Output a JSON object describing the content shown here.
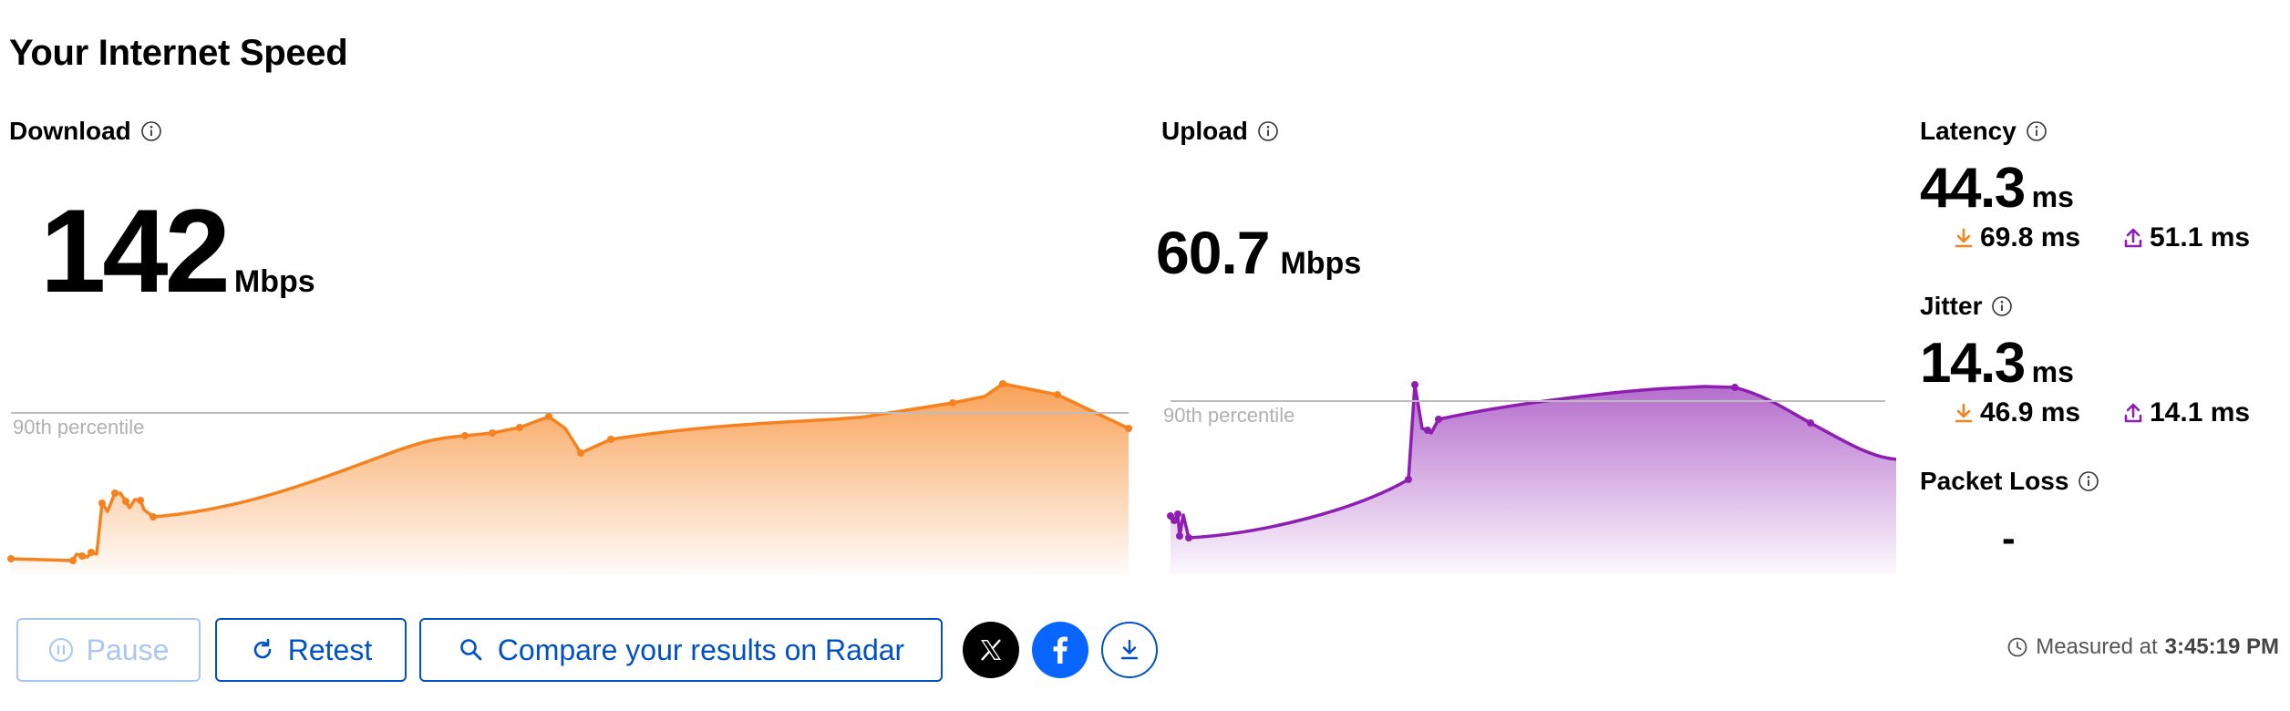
{
  "page": {
    "title": "Your Internet Speed"
  },
  "download": {
    "label": "Download",
    "value": "142",
    "unit": "Mbps",
    "percentile_label": "90th percentile",
    "color": "#f6821f",
    "icon": "info-icon"
  },
  "upload": {
    "label": "Upload",
    "value": "60.7",
    "unit": "Mbps",
    "percentile_label": "90th percentile",
    "color": "#8d1eb1",
    "icon": "info-icon"
  },
  "latency": {
    "label": "Latency",
    "value": "44.3",
    "unit": "ms",
    "download_value": "69.8 ms",
    "upload_value": "51.1 ms"
  },
  "jitter": {
    "label": "Jitter",
    "value": "14.3",
    "unit": "ms",
    "download_value": "46.9 ms",
    "upload_value": "14.1 ms"
  },
  "packet_loss": {
    "label": "Packet Loss",
    "value": "-"
  },
  "buttons": {
    "pause": "Pause",
    "retest": "Retest",
    "compare": "Compare your results on Radar"
  },
  "share": {
    "x_icon": "x-logo-icon",
    "facebook_icon": "facebook-icon",
    "download_icon": "download-icon"
  },
  "measured": {
    "prefix": "Measured at",
    "time": "3:45:19 PM"
  },
  "colors": {
    "accent": "#0051c3",
    "download": "#f6821f",
    "upload": "#8d1eb1"
  }
}
